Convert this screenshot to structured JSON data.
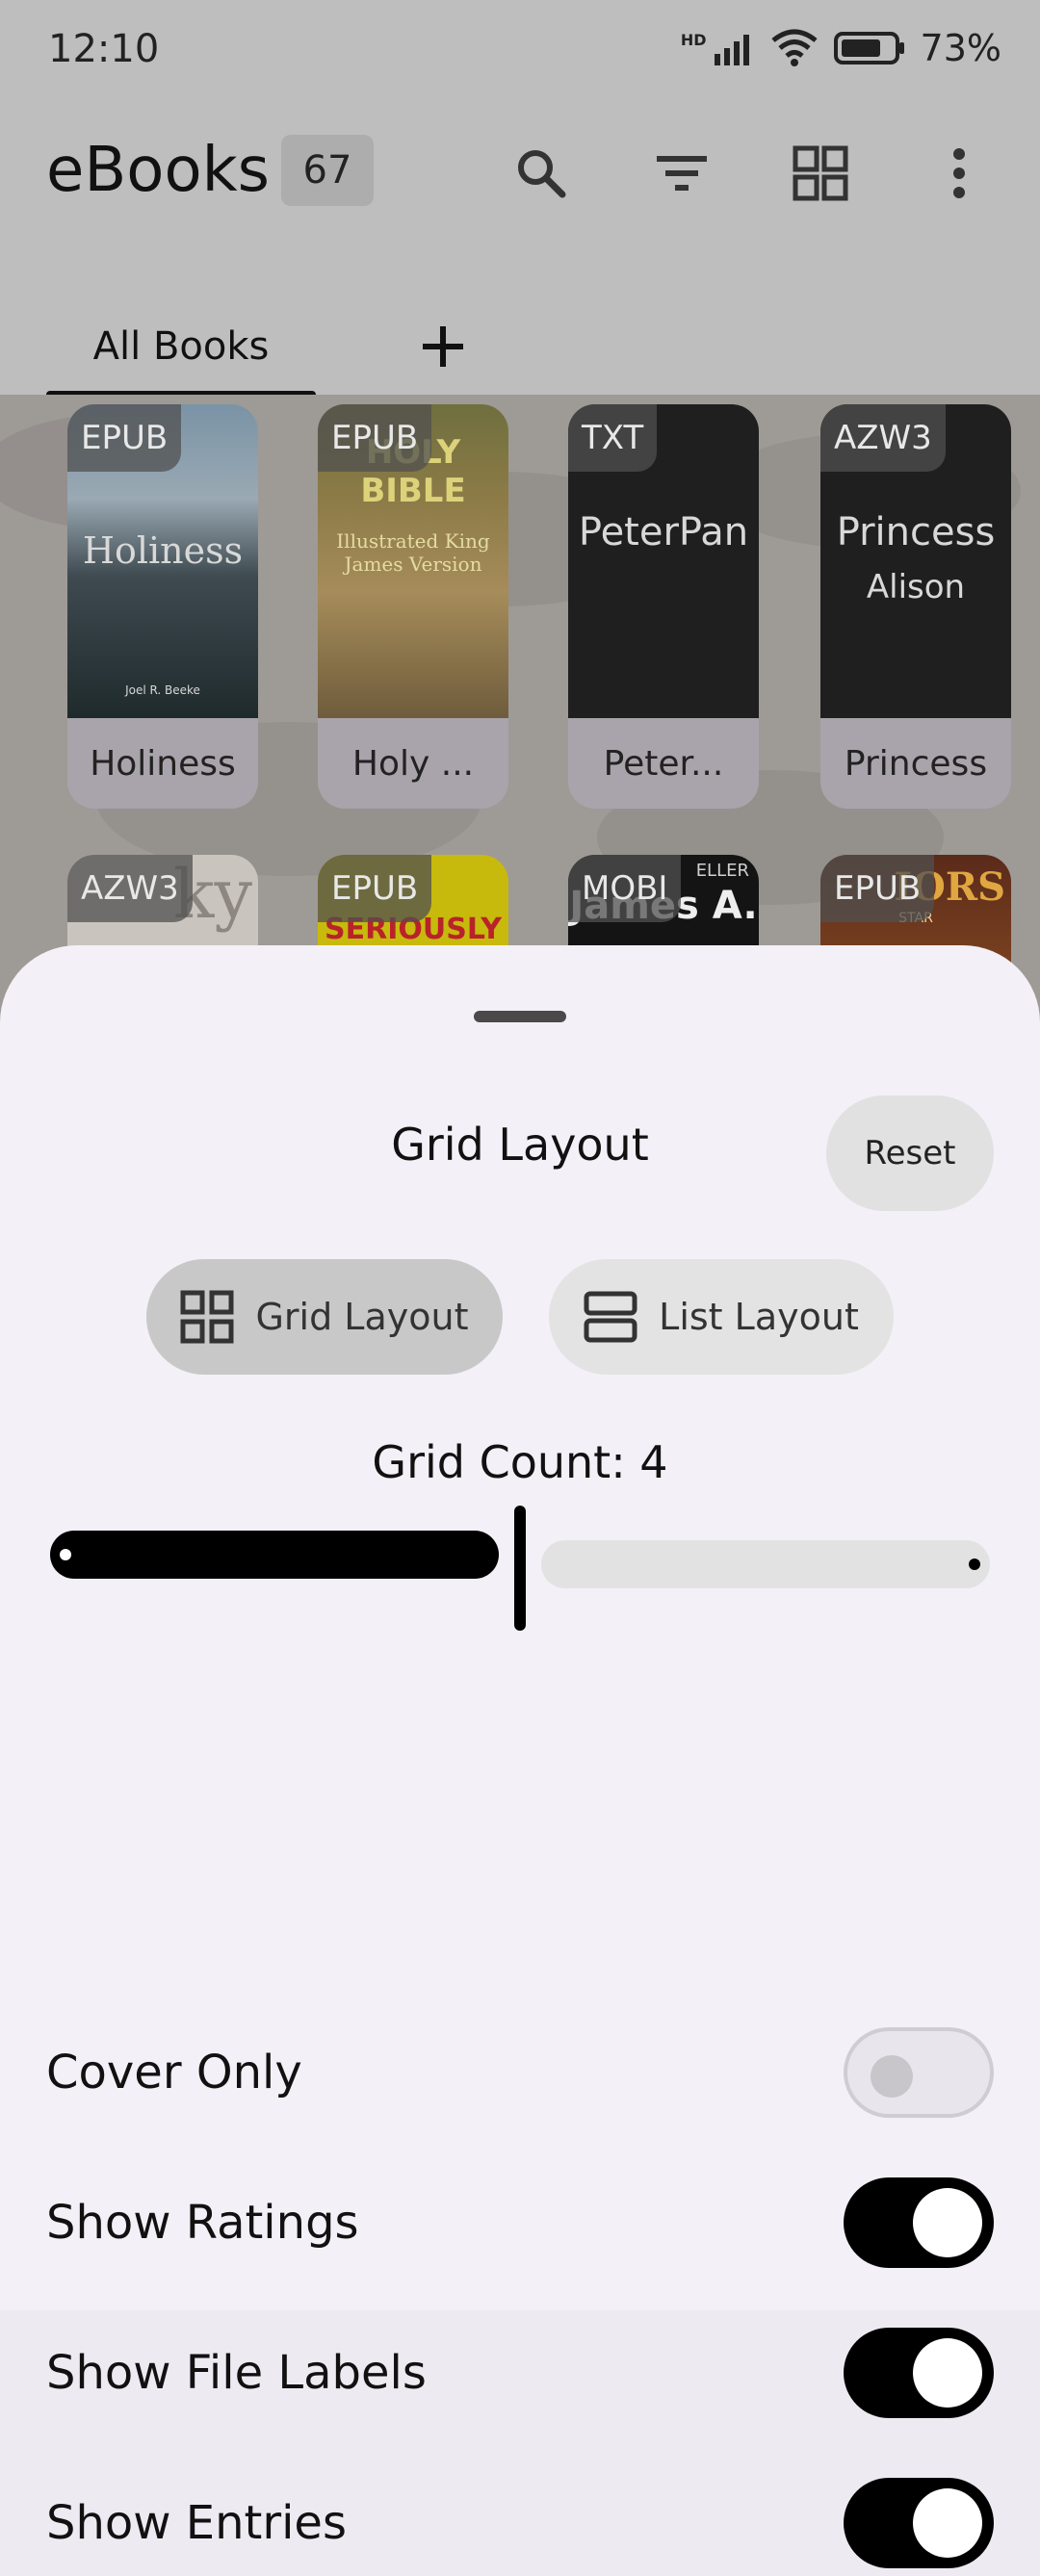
{
  "status_bar": {
    "time": "12:10",
    "battery": "73%",
    "network": "HD"
  },
  "app_bar": {
    "title": "eBooks",
    "count": "67",
    "icons": [
      "search-icon",
      "filter-icon",
      "grid-view-icon",
      "more-vert-icon"
    ]
  },
  "tabs": [
    {
      "label": "All Books",
      "selected": true
    }
  ],
  "books": [
    {
      "label": "EPUB",
      "title": "Holiness",
      "cover_text": "Holiness",
      "cover_subtext": "Joel R. Beeke"
    },
    {
      "label": "EPUB",
      "title": "Holy ...",
      "cover_text": "HOLY BIBLE",
      "cover_subtext": "Illustrated King James Version"
    },
    {
      "label": "TXT",
      "title": "Peter...",
      "cover_text": "PeterPan",
      "cover_subtext": ""
    },
    {
      "label": "AZW3",
      "title": "Princess",
      "cover_text": "Princess",
      "cover_subtext": "Alison"
    },
    {
      "label": "AZW3",
      "title": "",
      "cover_text": "ky",
      "cover_subtext": ""
    },
    {
      "label": "EPUB",
      "title": "",
      "cover_text": "SERIOUSLY",
      "cover_subtext": ""
    },
    {
      "label": "MOBI",
      "title": "",
      "cover_text": "James A.",
      "cover_subtext": "ELLER"
    },
    {
      "label": "EPUB",
      "title": "",
      "cover_text": "IORS",
      "cover_subtext": "STAR"
    }
  ],
  "sheet": {
    "title": "Grid Layout",
    "reset_label": "Reset",
    "layout_options": [
      {
        "label": "Grid Layout",
        "icon": "grid-icon",
        "selected": true
      },
      {
        "label": "List Layout",
        "icon": "list-icon",
        "selected": false
      }
    ],
    "grid_count_label": "Grid Count: 4",
    "grid_count": {
      "value": 4,
      "min": 2,
      "max": 6
    },
    "settings": [
      {
        "label": "Cover Only",
        "enabled": false
      },
      {
        "label": "Show Ratings",
        "enabled": true
      },
      {
        "label": "Show File Labels",
        "enabled": true
      },
      {
        "label": "Show Entries",
        "enabled": true
      }
    ]
  },
  "colors": {
    "accent": "#000000",
    "sheet_bg": "#f3f0f7",
    "scrim": "#bebebe"
  }
}
